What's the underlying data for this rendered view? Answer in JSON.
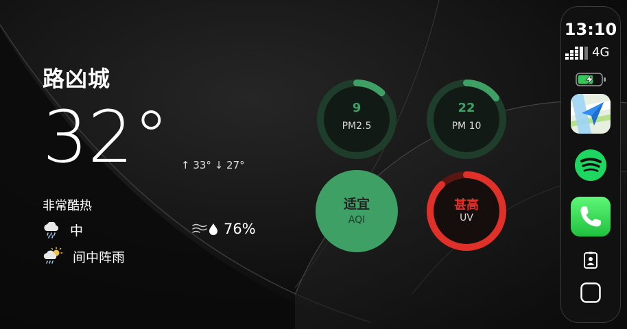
{
  "weather": {
    "city": "路凶城",
    "temperature": "32°",
    "high_low": "↑ 33° ↓ 27°",
    "condition": "非常酷热",
    "rain_level": "中",
    "humidity": "76%",
    "forecast": "间中阵雨",
    "icons": [
      "rain-cloud-icon",
      "wind-icon",
      "droplet-icon",
      "sun-cloud-rain-icon"
    ]
  },
  "air": {
    "pm25": {
      "value": "9",
      "label": "PM2.5",
      "level": 0.12
    },
    "pm10": {
      "value": "22",
      "label": "PM 10",
      "level": 0.15
    },
    "aqi": {
      "value": "适宜",
      "label": "AQI"
    },
    "uv": {
      "value": "甚高",
      "label": "UV",
      "level": 0.88
    }
  },
  "status": {
    "time": "13:10",
    "network": "4G"
  },
  "dock": {
    "apps": [
      "maps-app",
      "spotify-app",
      "phone-app"
    ],
    "bottom_icons": [
      "contact-card-icon",
      "home-square-icon"
    ]
  },
  "colors": {
    "green": "#3ea065",
    "green_dark": "#1f3d2b",
    "red": "#e0302a",
    "red_dark": "#5a1612",
    "background": "#0b0b0b"
  }
}
